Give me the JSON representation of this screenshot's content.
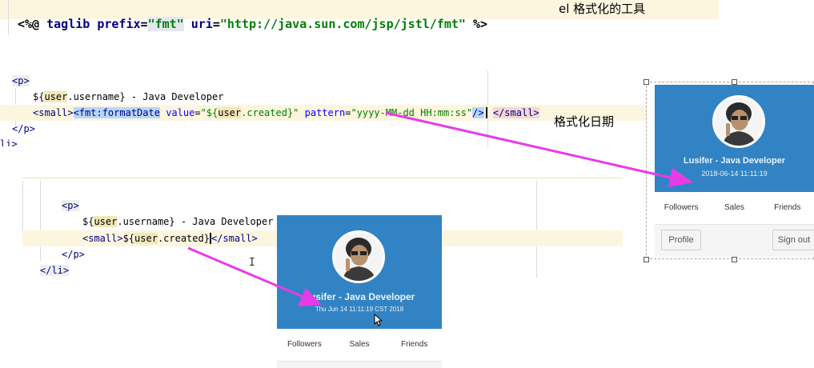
{
  "top_code": {
    "open": "<%@",
    "directive": "taglib",
    "prefix_attr": "prefix",
    "prefix_val": "\"fmt\"",
    "uri_attr": "uri",
    "uri_val": "\"http://java.sun.com/jsp/jstl/fmt\"",
    "close": "%>",
    "note": "el 格式化的工具"
  },
  "editor1": {
    "line1": "<p>",
    "line2_a": "${",
    "line2_var": "user",
    "line2_b": ".username}",
    "line2_c": " - Java Developer",
    "line3_small": "<small>",
    "line3_fmt": "<fmt:formatDate",
    "line3_value_attr": "value",
    "line3_value_a": "\"${",
    "line3_value_var": "user",
    "line3_value_b": ".created}\"",
    "line3_pattern_attr": "pattern",
    "line3_pattern_val": "\"yyyy-MM-dd HH:mm:ss\"",
    "line3_selfclose": "/>",
    "line3_close": "</small>",
    "line4": "</p>",
    "line5": "li>",
    "note": "格式化日期"
  },
  "editor2": {
    "line1": "<p>",
    "line2_a": "${",
    "line2_var": "user",
    "line2_b": ".username}",
    "line2_c": " - Java Developer",
    "line3_small": "<small>",
    "line3_a": "${",
    "line3_var": "user",
    "line3_b": ".created}",
    "line3_close": "</small>",
    "line4": "</p>",
    "line5": "</li>"
  },
  "card_right": {
    "name": "Lusifer - Java Developer",
    "date": "2018-06-14 11:11:19",
    "stats": [
      "Followers",
      "Sales",
      "Friends"
    ],
    "profile_btn": "Profile",
    "signout_btn": "Sign out"
  },
  "card_bottom": {
    "name": "Lusifer - Java Developer",
    "date": "Thu Jun 14 11:11:19 CST 2018",
    "stats": [
      "Followers",
      "Sales",
      "Friends"
    ]
  },
  "colors": {
    "arrow": "#e83be8",
    "card_header": "#3283c3"
  }
}
